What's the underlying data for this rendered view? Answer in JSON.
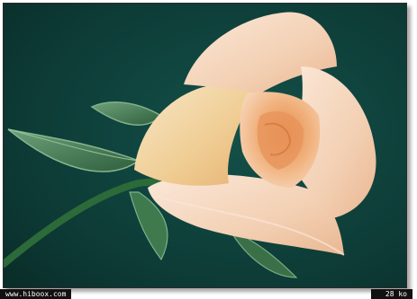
{
  "photo": {
    "subject": "",
    "colors": {
      "background": "#0f3a36",
      "petal_light": "#f6dcc7",
      "petal_mid": "#f1c59f",
      "petal_deep": "#eea26c",
      "stem": "#2d6b39",
      "leaf": "#5c8f66"
    }
  },
  "footer": {
    "site": "www.hiboox.com",
    "size": "28 ko"
  }
}
